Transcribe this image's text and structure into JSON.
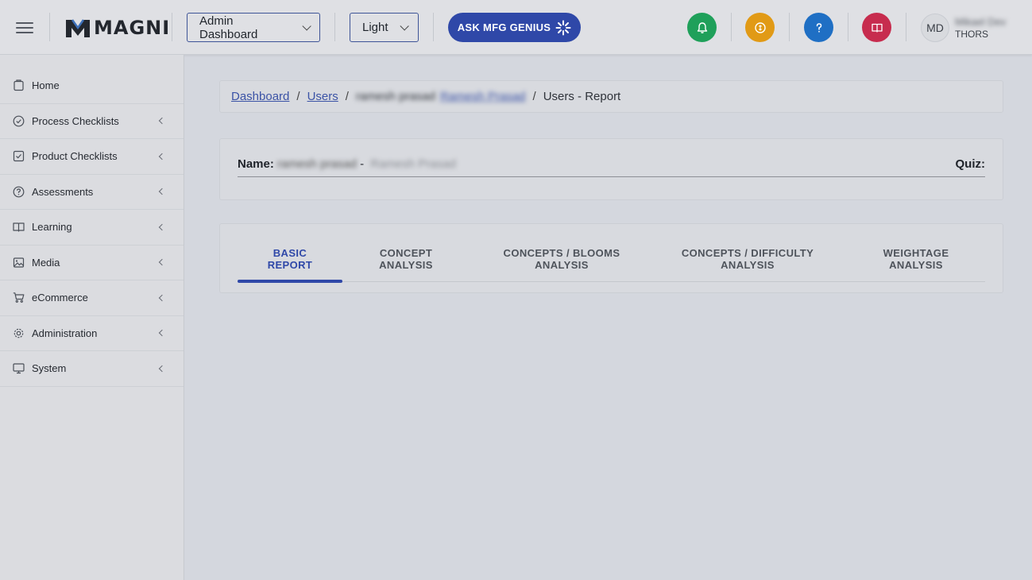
{
  "header": {
    "logo_text": "MAGNI",
    "dashboard_select": "Admin Dashboard",
    "theme_select": "Light",
    "genius_button": "ASK MFG GENIUS",
    "avatar_initials": "MD",
    "user_name": "Mikael Dev",
    "user_org": "THORS",
    "colors": {
      "notify": "#1fa05a",
      "coins": "#e19a16",
      "help": "#1f6fc4",
      "book": "#c72c4e",
      "accent": "#2f48a8"
    }
  },
  "sidebar": {
    "items": [
      {
        "label": "Home",
        "icon": "home-icon"
      },
      {
        "label": "Process Checklists",
        "icon": "check-circle-icon"
      },
      {
        "label": "Product Checklists",
        "icon": "check-square-icon"
      },
      {
        "label": "Assessments",
        "icon": "question-circle-icon"
      },
      {
        "label": "Learning",
        "icon": "book-open-icon"
      },
      {
        "label": "Media",
        "icon": "image-icon"
      },
      {
        "label": "eCommerce",
        "icon": "cart-icon"
      },
      {
        "label": "Administration",
        "icon": "gear-icon"
      },
      {
        "label": "System",
        "icon": "monitor-icon"
      }
    ]
  },
  "breadcrumb": {
    "dashboard": "Dashboard",
    "users": "Users",
    "user_id": "ramesh prasad",
    "user_link": "Ramesh Prasad",
    "current": "Users - Report",
    "sep": "/"
  },
  "profile": {
    "name_label": "Name:",
    "name_value": "ramesh prasad",
    "name_dash": "-",
    "name_alt": "Ramesh Prasad",
    "quiz_label": "Quiz:"
  },
  "tabs": [
    {
      "line1": "BASIC",
      "line2": "REPORT"
    },
    {
      "line1": "CONCEPT",
      "line2": "ANALYSIS"
    },
    {
      "line1": "CONCEPTS / BLOOMS",
      "line2": "ANALYSIS"
    },
    {
      "line1": "CONCEPTS / DIFFICULTY",
      "line2": "ANALYSIS"
    },
    {
      "line1": "WEIGHTAGE",
      "line2": "ANALYSIS"
    }
  ]
}
